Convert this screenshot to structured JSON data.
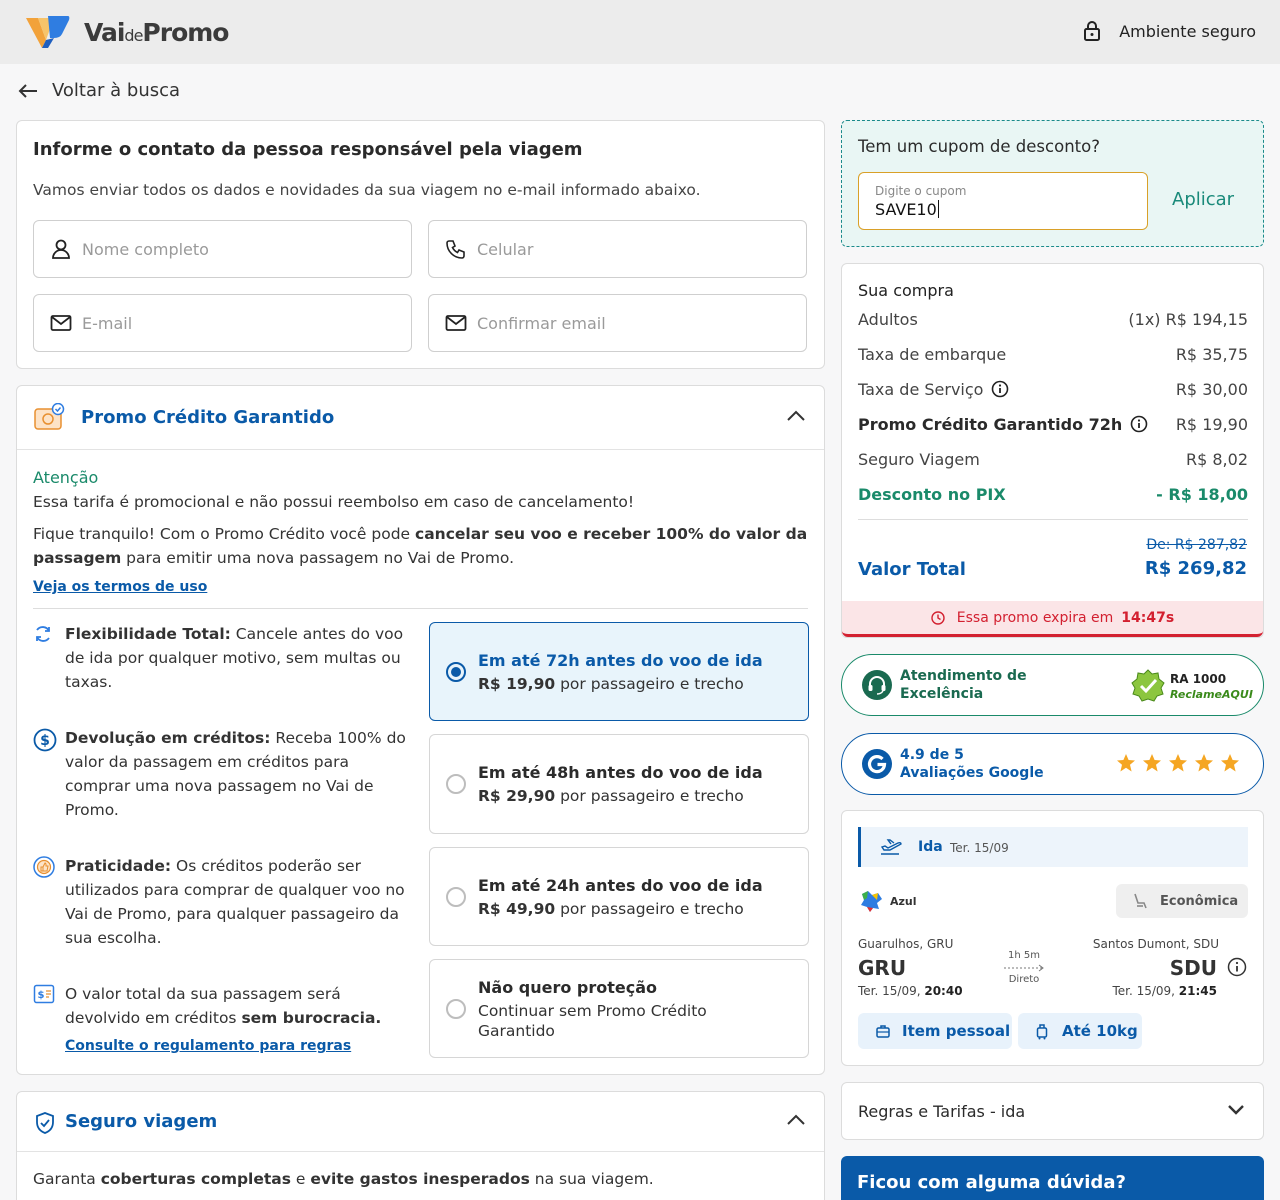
{
  "header": {
    "brand_main": "Vai",
    "brand_small": "de",
    "brand_end": "Promo",
    "secure_label": "Ambiente seguro"
  },
  "back_label": "Voltar à busca",
  "contact": {
    "title": "Informe o contato da pessoa responsável pela viagem",
    "subtitle": "Vamos enviar todos os dados e novidades da sua viagem no e-mail informado abaixo.",
    "name_placeholder": "Nome completo",
    "phone_placeholder": "Celular",
    "email_placeholder": "E-mail",
    "confirm_email_placeholder": "Confirmar email"
  },
  "promo": {
    "title": "Promo Crédito Garantido",
    "attention": "Atenção",
    "warning": "Essa tarifa é promocional e não possui reembolso em caso de cancelamento!",
    "desc_1": "Fique tranquilo! Com o Promo Crédito você pode ",
    "desc_bold": "cancelar seu voo e receber 100% do valor da passagem",
    "desc_2": " para emitir uma nova passagem no Vai de Promo.",
    "terms_link": "Veja os termos de uso",
    "features": [
      {
        "bold": "Flexibilidade Total:",
        "text": " Cancele antes do voo de ida por qualquer motivo, sem multas ou taxas."
      },
      {
        "bold": "Devolução em créditos:",
        "text": " Receba 100% do valor da passagem em créditos para comprar uma nova passagem no Vai de Promo."
      },
      {
        "bold": "Praticidade:",
        "text": " Os créditos poderão ser utilizados para comprar de qualquer voo no Vai de Promo, para qualquer passageiro da sua escolha."
      },
      {
        "text_1": "O valor total da sua passagem será devolvido em créditos ",
        "bold": "sem burocracia."
      }
    ],
    "rules_link": "Consulte o regulamento para regras",
    "options": [
      {
        "title": "Em até 72h antes do voo de ida",
        "price": "R$ 19,90",
        "suffix": " por passageiro e trecho"
      },
      {
        "title": "Em até 48h antes do voo de ida",
        "price": "R$ 29,90",
        "suffix": " por passageiro e trecho"
      },
      {
        "title": "Em até 24h antes do voo de ida",
        "price": "R$ 49,90",
        "suffix": " por passageiro e trecho"
      },
      {
        "title": "Não quero proteção",
        "subtitle": "Continuar sem Promo Crédito Garantido"
      }
    ]
  },
  "seguro": {
    "title": "Seguro viagem",
    "text_1": "Garanta ",
    "bold_1": "coberturas completas",
    "text_2": " e ",
    "bold_2": "evite gastos inesperados",
    "text_3": " na sua viagem."
  },
  "coupon": {
    "title": "Tem um cupom de desconto?",
    "label": "Digite o cupom",
    "value": "SAVE10",
    "apply": "Aplicar"
  },
  "purchase": {
    "title": "Sua compra",
    "rows": [
      {
        "label": "Adultos",
        "value": "(1x) R$ 194,15"
      },
      {
        "label": "Taxa de embarque",
        "value": "R$ 35,75"
      },
      {
        "label": "Taxa de Serviço",
        "value": "R$ 30,00"
      },
      {
        "label": "Promo Crédito Garantido 72h",
        "value": "R$ 19,90"
      },
      {
        "label": "Seguro Viagem",
        "value": "R$ 8,02"
      },
      {
        "label": "Desconto no PIX",
        "value": "- R$ 18,00"
      }
    ],
    "old_price": "De: R$ 287,82",
    "total_label": "Valor Total",
    "total_value": "R$ 269,82",
    "expire_label": "Essa promo expira em",
    "expire_time": "14:47s"
  },
  "badges": {
    "service_1": "Atendimento de",
    "service_2": "Excelência",
    "ra_1": "RA 1000",
    "ra_2": "ReclameAQUI",
    "google_1": "4.9 de 5",
    "google_2": "Avaliações Google",
    "google_rating": 5
  },
  "flight": {
    "leg": "Ida",
    "date": "Ter. 15/09",
    "airline": "Azul",
    "cabin": "Econômica",
    "origin_city": "Guarulhos, GRU",
    "origin_code": "GRU",
    "origin_date": "Ter. 15/09,",
    "origin_time": "20:40",
    "duration": "1h 5m",
    "stops": "Direto",
    "dest_city": "Santos Dumont, SDU",
    "dest_code": "SDU",
    "dest_date": "Ter. 15/09,",
    "dest_time": "21:45",
    "bag_1": "Item pessoal",
    "bag_2": "Até 10kg"
  },
  "rules_title": "Regras e Tarifas - ida",
  "help_title": "Ficou com alguma dúvida?",
  "colors": {
    "brand_blue": "#0a5aa8",
    "green": "#1a8a6a",
    "red": "#d32030",
    "coupon_border": "#d9a028"
  }
}
